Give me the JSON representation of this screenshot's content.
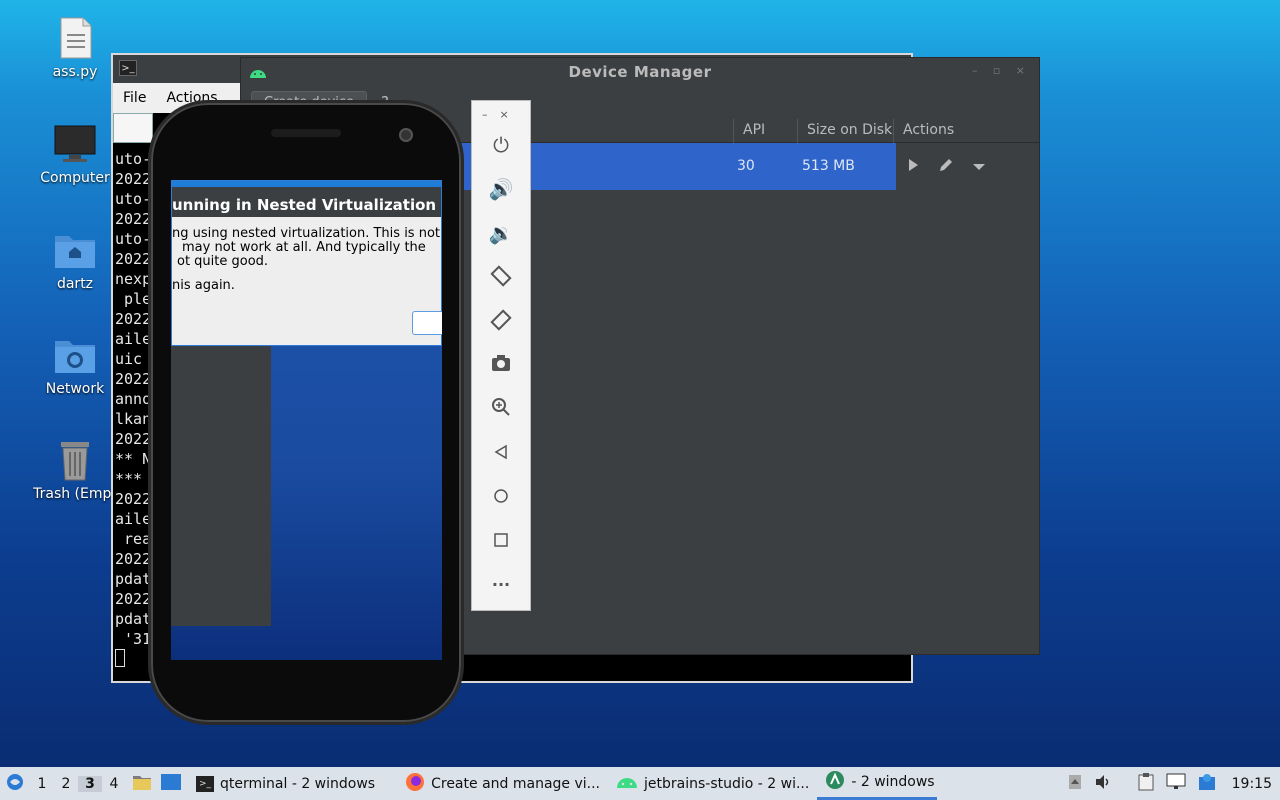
{
  "desktop": {
    "icons": [
      {
        "label": "ass.py"
      },
      {
        "label": "Computer"
      },
      {
        "label": "dartz"
      },
      {
        "label": "Network"
      },
      {
        "label": "Trash (Empt"
      }
    ]
  },
  "terminal": {
    "menu": {
      "file": "File",
      "actions": "Actions"
    },
    "lines": [
      "uto-",
      "2022",
      "uto-",
      "2022",
      "uto-",
      "2022",
      "nexp",
      " ple",
      "2022",
      "aile",
      "uic",
      "2022",
      "anno",
      "lkan",
      "2022",
      "** N",
      "***",
      "2022",
      "aile",
      " rea",
      "2022",
      "pdat",
      "2022",
      "pdat",
      " '31"
    ]
  },
  "device_manager": {
    "title": "Device Manager",
    "create_label": "Create device",
    "help_label": "?",
    "columns": {
      "api": "API",
      "size": "Size on Disk",
      "actions": "Actions"
    },
    "row": {
      "api": "30",
      "size": "513 MB"
    }
  },
  "emulator": {
    "dialog": {
      "title": "unning in Nested Virtualization",
      "line1": "ng using nested virtualization. This is not",
      "line2": "may not work at all. And typically the",
      "line3": "ot quite good.",
      "line4": "nis again."
    }
  },
  "taskbar": {
    "workspaces": [
      "1",
      "2",
      "3",
      "4"
    ],
    "tasks": [
      {
        "label": "qterminal - 2 windows"
      },
      {
        "label": "Create and manage vi..."
      },
      {
        "label": "jetbrains-studio - 2 wi..."
      },
      {
        "label": "- 2 windows"
      }
    ],
    "clock": "19:15"
  }
}
